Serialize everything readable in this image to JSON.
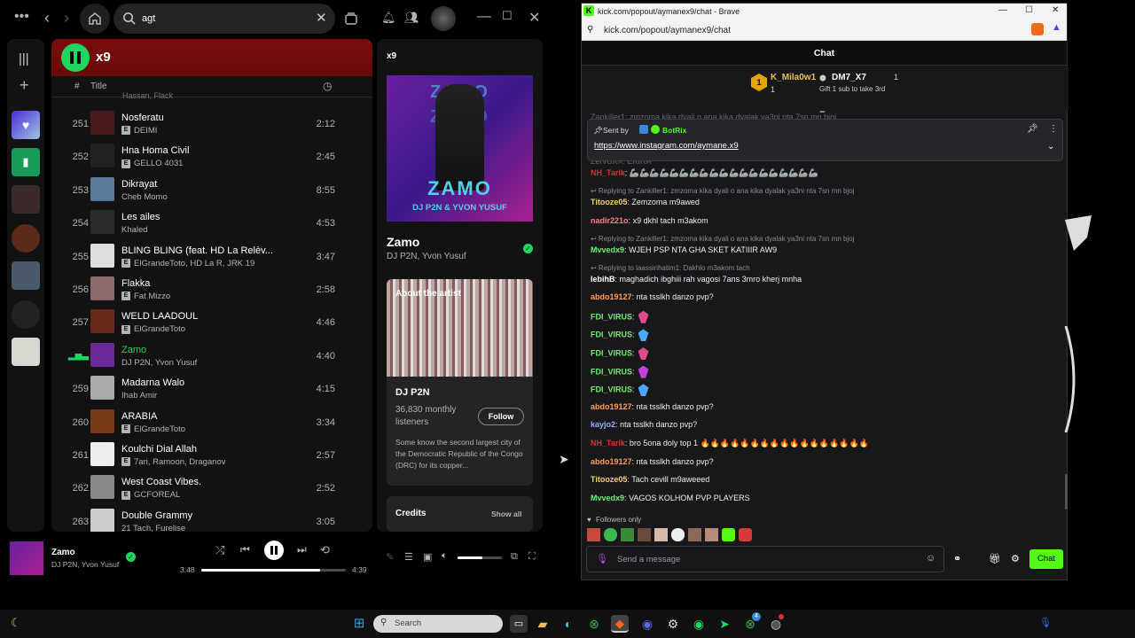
{
  "spotify": {
    "search_value": "agt",
    "playlist_title": "x9",
    "col_num": "#",
    "col_title": "Title",
    "partial_artist": "Hassan, Flack",
    "tracks": [
      {
        "num": "251",
        "title": "Nosferatu",
        "artist": "DEIMI",
        "dur": "2:12",
        "color": "#4a1a1a",
        "explicit": true,
        "active": false
      },
      {
        "num": "252",
        "title": "Hna Homa Civil",
        "artist": "GELLO 4031",
        "dur": "2:45",
        "color": "#222",
        "explicit": true,
        "active": false
      },
      {
        "num": "253",
        "title": "Dikrayat",
        "artist": "Cheb Momo",
        "dur": "8:55",
        "color": "#5a7a9a",
        "explicit": false,
        "active": false
      },
      {
        "num": "254",
        "title": "Les ailes",
        "artist": "Khaled",
        "dur": "4:53",
        "color": "#2a2a2a",
        "explicit": false,
        "active": false
      },
      {
        "num": "255",
        "title": "BLING BLING (feat. HD La Relèv...",
        "artist": "ElGrandeToto, HD La R, JRK 19",
        "dur": "3:47",
        "color": "#ddd",
        "explicit": true,
        "active": false
      },
      {
        "num": "256",
        "title": "Flakka",
        "artist": "Fat Mizzo",
        "dur": "2:58",
        "color": "#8a6a6a",
        "explicit": true,
        "active": false
      },
      {
        "num": "257",
        "title": "WELD LAADOUL",
        "artist": "ElGrandeToto",
        "dur": "4:46",
        "color": "#6a2a1a",
        "explicit": true,
        "active": false
      },
      {
        "num": "",
        "title": "Zamo",
        "artist": "DJ P2N, Yvon Yusuf",
        "dur": "4:40",
        "color": "#6a2a9a",
        "explicit": false,
        "active": true
      },
      {
        "num": "259",
        "title": "Madarna Walo",
        "artist": "Ihab Amir",
        "dur": "4:15",
        "color": "#aaa",
        "explicit": false,
        "active": false
      },
      {
        "num": "260",
        "title": "ARABIA",
        "artist": "ElGrandeToto",
        "dur": "3:34",
        "color": "#7a3a1a",
        "explicit": true,
        "active": false
      },
      {
        "num": "261",
        "title": "Koulchi Dial Allah",
        "artist": "7ari, Ramoon, Draganov",
        "dur": "2:57",
        "color": "#eee",
        "explicit": true,
        "active": false
      },
      {
        "num": "262",
        "title": "West Coast Vibes.",
        "artist": "GCFOREAL",
        "dur": "2:52",
        "color": "#888",
        "explicit": true,
        "active": false
      },
      {
        "num": "263",
        "title": "Double Grammy",
        "artist": "21 Tach, Furelise",
        "dur": "3:05",
        "color": "#ccc",
        "explicit": false,
        "active": false
      }
    ],
    "now_playing": {
      "header": "x9",
      "cover_top": "ZAMO",
      "cover_artists": "DJ P2N & YVON YUSUF",
      "title": "Zamo",
      "artists": "DJ P2N, Yvon Yusuf",
      "about_label": "About the artist",
      "artist_name": "DJ P2N",
      "listeners": "36,830 monthly listeners",
      "follow": "Follow",
      "bio": "Some know the second largest city of the Democratic Republic of the Congo (DRC) for its copper...",
      "credits": "Credits",
      "show_all": "Show all"
    },
    "player": {
      "title": "Zamo",
      "artist": "DJ P2N, Yvon Yusuf",
      "elapsed": "3:48",
      "total": "4:39",
      "progress": 0.82,
      "volume": 0.55
    },
    "accent": "#1ed760"
  },
  "brave": {
    "tab_title": "kick.com/popout/aymanex9/chat - Brave",
    "url": "kick.com/popout/aymanex9/chat",
    "chat_title": "Chat",
    "leaders": [
      {
        "name": "K_Mila0w1",
        "count": "1"
      },
      {
        "name": "DM7_X7",
        "count": "1"
      }
    ],
    "gift_note": "Gift 1 sub to take 3rd",
    "pinned_sender_label": "Sent by",
    "pinned_sender": "BotRix",
    "pinned_link": "https://www.instagram.com/aymane.x9",
    "partial_top": "Zankiller1: zmzoma kika dyali o ana kika dyalak ya3ni nta 7sn mn bjoj",
    "partial_second": "ZervUXX: EKIRA",
    "messages": [
      {
        "type": "msg",
        "user": "NH_Tarik",
        "color": "#e03030",
        "text": "🦾🦾🦾🦾🦾🦾🦾🦾🦾🦾🦾🦾🦾🦾🦾🦾🦾🦾🦾"
      },
      {
        "type": "reply",
        "text": "↩ Replying to Zankiller1: zmzoma kika dyali o ana kika dyalak ya3ni nta 7sn mn bjoj"
      },
      {
        "type": "msg",
        "user": "Titooze05",
        "color": "#f5d36b",
        "text": "Zemzoma m9awed"
      },
      {
        "type": "msg",
        "user": "nadir221o",
        "color": "#ff7e7e",
        "text": "x9 dkhl tach m3akom"
      },
      {
        "type": "reply",
        "text": "↩ Replying to Zankiller1: zmzoma kika dyali o ana kika dyalak ya3ni nta 7sn mn bjoj"
      },
      {
        "type": "msg",
        "user": "Mvvedx9",
        "color": "#6cf06c",
        "text": "WJEH PSP NTA GHA SKET KATIIIR AW9"
      },
      {
        "type": "reply",
        "text": "↩ Replying to laassirihatim1: Dakhlo m3akom tach"
      },
      {
        "type": "msg",
        "user": "lebihB",
        "color": "#ffffff",
        "text": "maghadich ibghiii rah vagosi 7ans 3mro kherj mnha"
      },
      {
        "type": "msg",
        "user": "abdo19127",
        "color": "#ff9d5c",
        "text": "nta tsslkh danzo pvp?"
      },
      {
        "type": "msg",
        "user": "FDI_VIRUS",
        "color": "#6cf06c",
        "text": "🦋",
        "emote": "#e24a8a"
      },
      {
        "type": "msg",
        "user": "FDI_VIRUS",
        "color": "#6cf06c",
        "text": "🦋",
        "emote": "#4aa8ff"
      },
      {
        "type": "msg",
        "user": "FDI_VIRUS",
        "color": "#6cf06c",
        "text": "🦋",
        "emote": "#e24a8a"
      },
      {
        "type": "msg",
        "user": "FDI_VIRUS",
        "color": "#6cf06c",
        "text": "🦋",
        "emote": "#c040e0"
      },
      {
        "type": "msg",
        "user": "FDI_VIRUS",
        "color": "#6cf06c",
        "text": "🦋",
        "emote": "#4aa8ff"
      },
      {
        "type": "msg",
        "user": "abdo19127",
        "color": "#ff9d5c",
        "text": "nta tsslkh danzo pvp?"
      },
      {
        "type": "msg",
        "user": "kayjo2",
        "color": "#8ab4ff",
        "text": "nta tsslkh danzo pvp?"
      },
      {
        "type": "msg",
        "user": "NH_Tarik",
        "color": "#e03030",
        "text": "bro 5ona doly top 1 🔥🔥🔥🔥🔥🔥🔥🔥🔥🔥🔥🔥🔥🔥🔥🔥🔥"
      },
      {
        "type": "msg",
        "user": "abdo19127",
        "color": "#ff9d5c",
        "text": "nta tsslkh danzo pvp?"
      },
      {
        "type": "msg",
        "user": "Titooze05",
        "color": "#f5d36b",
        "text": "Tach cevill m9aweeed"
      },
      {
        "type": "msg",
        "user": "Mvvedx9",
        "color": "#6cf06c",
        "text": "VAGOS KOLHOM PVP PLAYERS"
      }
    ],
    "followers_only": "Followers only",
    "send_placeholder": "Send a message",
    "chat_button": "Chat",
    "kick_green": "#53fc18"
  },
  "taskbar": {
    "search_placeholder": "Search",
    "badge": "4"
  }
}
